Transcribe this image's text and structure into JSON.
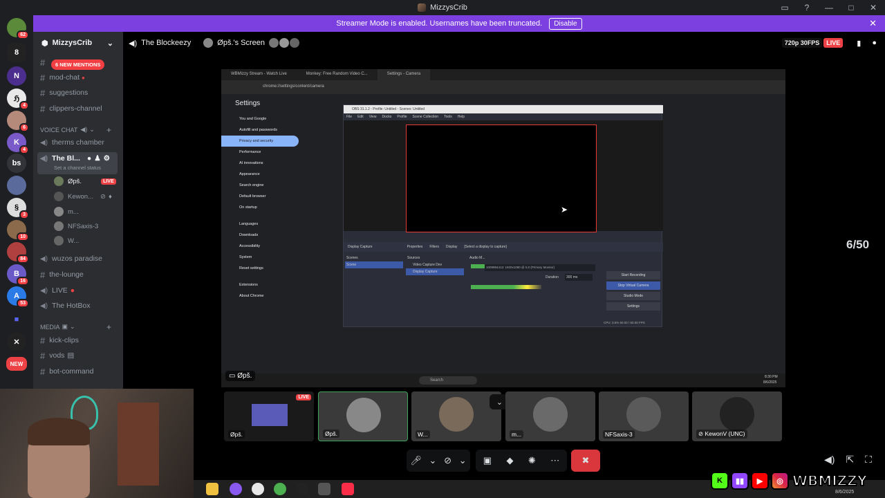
{
  "window": {
    "title": "MizzysCrib"
  },
  "banner": {
    "text": "Streamer Mode is enabled. Usernames have been truncated.",
    "disable_label": "Disable"
  },
  "servers": {
    "badges": [
      "62",
      "4",
      "6",
      "4",
      "3",
      "10",
      "84",
      "16",
      "53"
    ],
    "text_server": "bs",
    "new_label": "NEW"
  },
  "sidebar": {
    "server_name": "MizzysCrib",
    "mentions": "6 NEW MENTIONS",
    "channels": [
      "mod-chat",
      "suggestions",
      "clippers-channel"
    ],
    "voice_category": "VOICE CHAT",
    "voice_channels": [
      "therms chamber",
      "The Bl..."
    ],
    "channel_status": "Set a channel status",
    "voice_users": [
      "Øpš.",
      "Kewon...",
      "m...",
      "NFSaxis-3",
      "W..."
    ],
    "live_label": "LIVE",
    "more_channels": [
      "wuzos paradise",
      "the-lounge",
      "LIVE",
      "The HotBox"
    ],
    "media_category": "MEDIA",
    "media_channels": [
      "kick-clips",
      "vods",
      "bot-command"
    ]
  },
  "topbar": {
    "channel": "The Blockeezy",
    "screen": "Øpš.'s Screen",
    "quality": "720p 30FPS",
    "live": "LIVE"
  },
  "stream": {
    "counter": "6/50",
    "streamer_label": "Øpš.",
    "browser_tabs": [
      "WBMizzy Stream - Watch Live",
      "Monkey: Free Random Video C...",
      "Settings - Camera"
    ],
    "address": "chrome://settings/content/camera",
    "settings_title": "Settings",
    "settings_menu": [
      "You and Google",
      "Autofill and passwords",
      "Privacy and security",
      "Performance",
      "AI innovations",
      "Appearance",
      "Search engine",
      "Default browser",
      "On startup",
      "Languages",
      "Downloads",
      "Accessibility",
      "System",
      "Reset settings",
      "Extensions",
      "About Chrome"
    ],
    "obs_title": "OBS 31.1.2 - Profile: Untitled - Scenes: Untitled",
    "obs_menu": [
      "File",
      "Edit",
      "View",
      "Docks",
      "Profile",
      "Scene Collection",
      "Tools",
      "Help"
    ],
    "obs_source_bar": [
      "Display Capture",
      "Properties",
      "Filters",
      "Display",
      "[Select a display to capture]"
    ],
    "obs_panels": [
      "Scenes",
      "Sources",
      "Audio M..."
    ],
    "obs_scene": "Scene",
    "obs_sources": [
      "Video Capture Dev",
      "Display Capture"
    ],
    "obs_buttons": [
      "Start Recording",
      "Stop Virtual Camera",
      "Studio Mode",
      "Settings"
    ],
    "obs_duration": "Duration",
    "obs_duration_val": "300 ms",
    "obs_status": "CPU: 3.5%   60.00 / 60.00 FPS",
    "monitor": "1009994413: 1920x1080 @ 0,0 (Primary Monitor)",
    "search_placeholder": "Search",
    "clock": "8:30 PM",
    "date": "8/6/2025"
  },
  "tiles": [
    {
      "label": "Øpš.",
      "live": "LIVE"
    },
    {
      "label": "Øpš."
    },
    {
      "label": "W..."
    },
    {
      "label": "m..."
    },
    {
      "label": "NFSaxis-3"
    },
    {
      "label": "KewonV (UNC)"
    }
  ],
  "overlay": {
    "brand": "WBMIZZY",
    "date": "8/6/2025"
  }
}
